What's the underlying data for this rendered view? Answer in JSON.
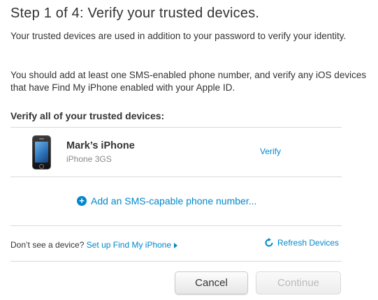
{
  "header": {
    "title": "Step 1 of 4: Verify your trusted devices.",
    "intro": "Your trusted devices are used in addition to your password to verify your identity.",
    "intro2": "You should add at least one SMS-enabled phone number, and verify any iOS devices that have Find My iPhone enabled with your Apple ID."
  },
  "devices_section": {
    "heading": "Verify all of your trusted devices:",
    "devices": [
      {
        "name": "Mark’s iPhone",
        "model": "iPhone 3GS",
        "action_label": "Verify",
        "icon": "iphone-icon"
      }
    ],
    "add_sms_label": "Add an SMS-capable phone number...",
    "add_icon": "plus-circle-icon"
  },
  "footer": {
    "missing_text": "Don’t see a device?",
    "setup_link": "Set up Find My iPhone",
    "refresh_label": "Refresh Devices",
    "refresh_icon": "refresh-icon"
  },
  "actions": {
    "cancel_label": "Cancel",
    "continue_label": "Continue",
    "continue_enabled": false
  },
  "colors": {
    "link": "#0088cc",
    "text": "#333333",
    "muted": "#888888",
    "disabled": "#bbbbbb"
  }
}
